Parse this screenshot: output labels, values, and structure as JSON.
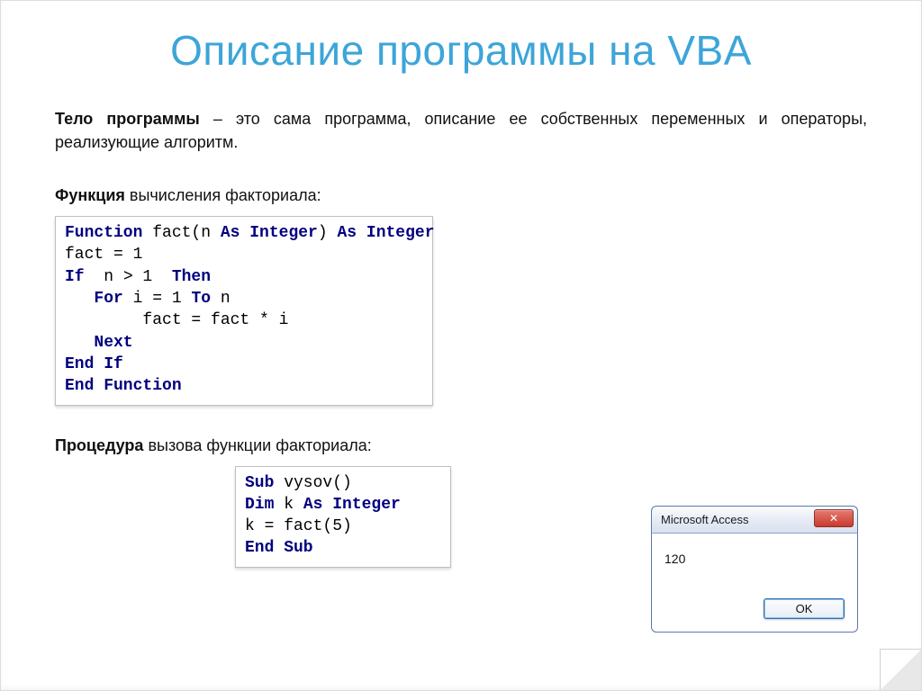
{
  "title": "Описание программы на VBA",
  "para_strong": "Тело программы",
  "para_rest": " – это сама программа, описание ее собственных переменных и операторы, реализующие алгоритм.",
  "label1_strong": "Функция",
  "label1_rest": " вычисления факториала:",
  "label2_strong": "Процедура",
  "label2_rest": " вызова функции факториала:",
  "code1": {
    "kw_function": "Function",
    "t1_a": " fact(n ",
    "kw_as1": "As Integer",
    "t1_b": ") ",
    "kw_as2": "As Integer",
    "l2": "fact = 1",
    "l3a": "If",
    "l3b": "  n > 1  ",
    "l3c": "Then",
    "l4a": "   For",
    "l4b": " i = 1 ",
    "l4c": "To",
    "l4d": " n",
    "l5": "        fact = fact * i",
    "l6": "   Next",
    "l7": "End If",
    "l8": "End Function"
  },
  "code2": {
    "kw_sub": "Sub",
    "t1": " vysov()",
    "kw_dim": "Dim",
    "t2a": " k ",
    "kw_as": "As Integer",
    "l3": "k = fact(5)",
    "kw_end": "End Sub"
  },
  "dialog": {
    "title": "Microsoft Access",
    "close_label": "✕",
    "message": "120",
    "ok_label": "OK"
  }
}
